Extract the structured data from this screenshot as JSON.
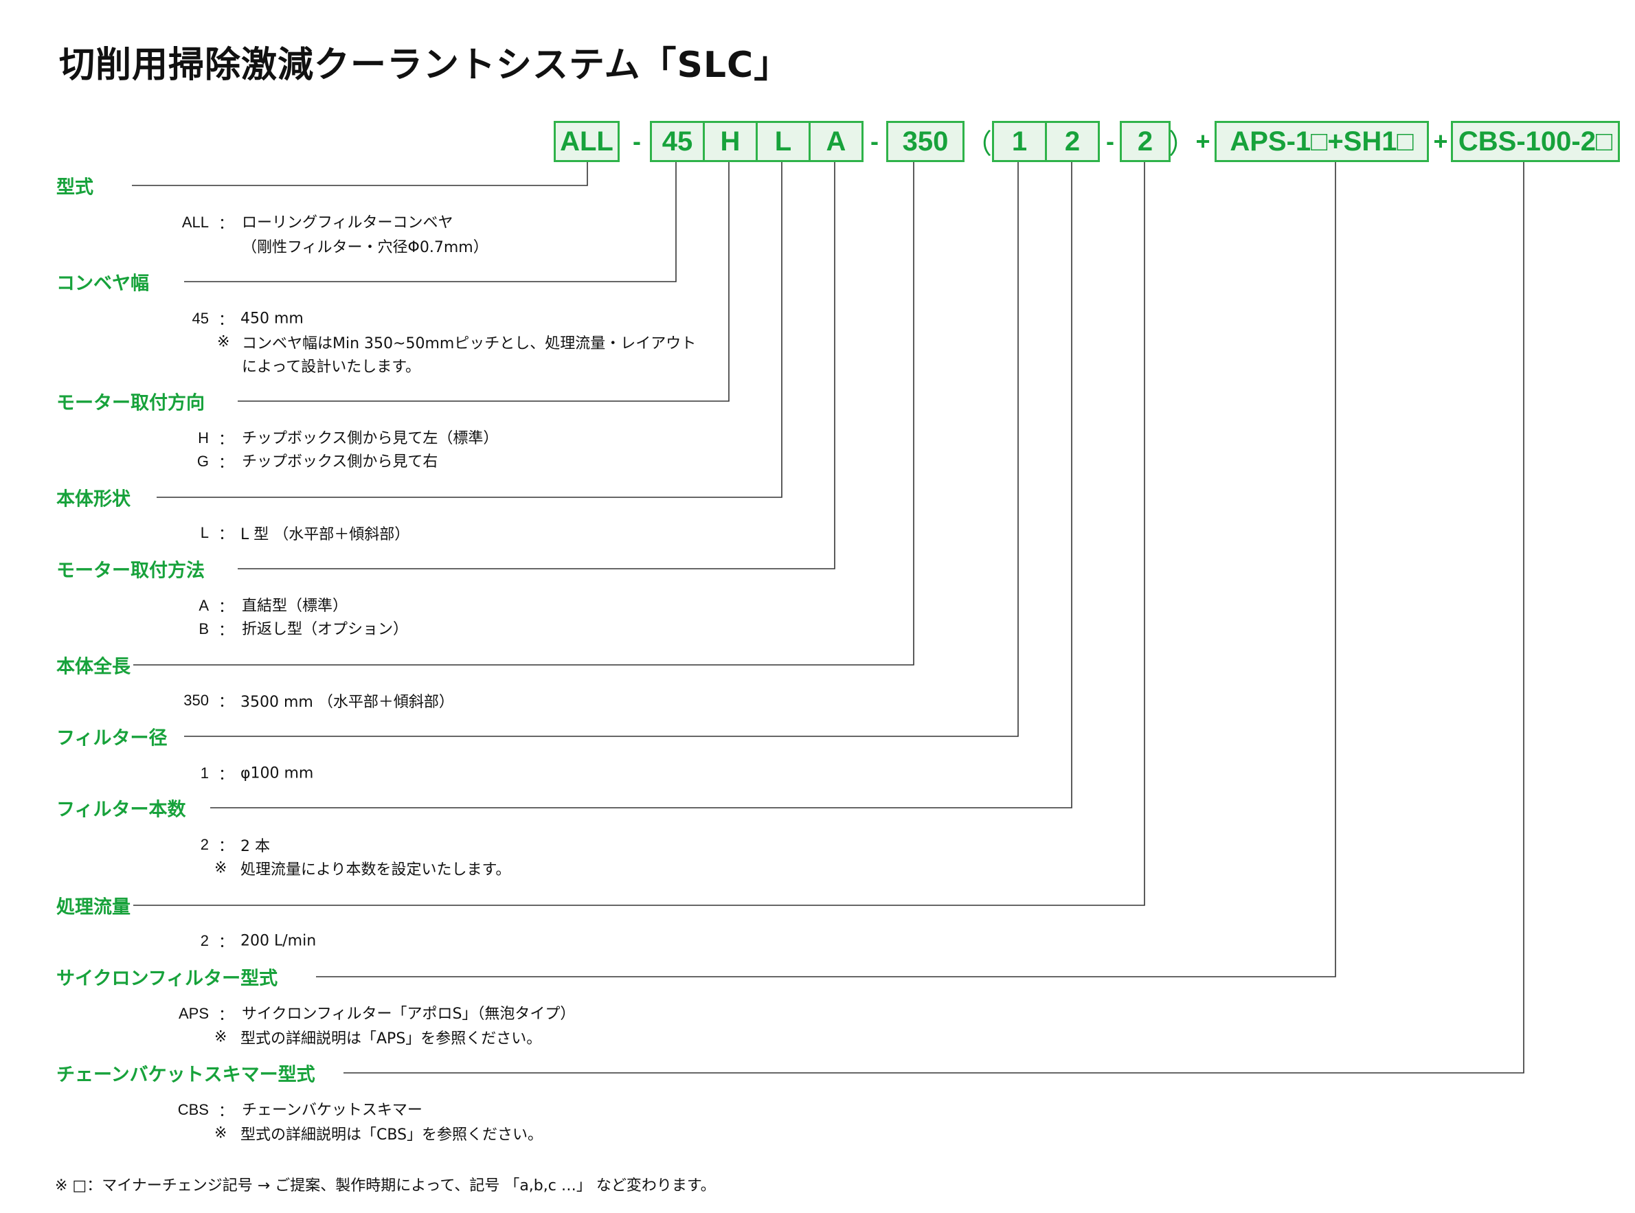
{
  "title": "切削用掃除激減クーラントシステム「SLC」",
  "colors": {
    "accent": "#17a23b",
    "box_border": "#2fb34a",
    "box_fill": "#e8f5ea"
  },
  "model_code": {
    "boxes": [
      "ALL",
      "45",
      "H",
      "L",
      "A",
      "350",
      "1",
      "2",
      "2",
      "APS-1□+SH1□",
      "CBS-100-2□"
    ],
    "dashes": [
      "-",
      "-",
      "-"
    ],
    "open_paren": "（",
    "close_paren": "）",
    "plus": [
      "+",
      "+"
    ]
  },
  "sections": [
    {
      "heading": "型式",
      "entries": [
        {
          "code": "ALL",
          "colon": "：",
          "lines": [
            "ローリングフィルターコンベヤ",
            "（剛性フィルター・穴径Φ0.7mm）"
          ]
        }
      ]
    },
    {
      "heading": "コンベヤ幅",
      "entries": [
        {
          "code": "45",
          "colon": "：",
          "lines": [
            "450 mm"
          ]
        }
      ],
      "notes": [
        {
          "mark": "※",
          "lines": [
            "コンベヤ幅はMin 350~50mmピッチとし、処理流量・レイアウト",
            "によって設計いたします。"
          ]
        }
      ]
    },
    {
      "heading": "モーター取付方向",
      "entries": [
        {
          "code": "H",
          "colon": "：",
          "lines": [
            "チップボックス側から見て左（標準）"
          ]
        },
        {
          "code": "G",
          "colon": "：",
          "lines": [
            "チップボックス側から見て右"
          ]
        }
      ]
    },
    {
      "heading": "本体形状",
      "entries": [
        {
          "code": "L",
          "colon": "：",
          "lines": [
            "L 型 （水平部＋傾斜部）"
          ]
        }
      ]
    },
    {
      "heading": "モーター取付方法",
      "entries": [
        {
          "code": "A",
          "colon": "：",
          "lines": [
            "直結型（標準）"
          ]
        },
        {
          "code": "B",
          "colon": "：",
          "lines": [
            "折返し型（オプション）"
          ]
        }
      ]
    },
    {
      "heading": "本体全長",
      "entries": [
        {
          "code": "350",
          "colon": "：",
          "lines": [
            "3500 mm （水平部＋傾斜部）"
          ]
        }
      ]
    },
    {
      "heading": "フィルター径",
      "entries": [
        {
          "code": "1",
          "colon": "：",
          "lines": [
            "φ100 mm"
          ]
        }
      ]
    },
    {
      "heading": "フィルター本数",
      "entries": [
        {
          "code": "2",
          "colon": "：",
          "lines": [
            "2 本"
          ]
        }
      ],
      "notes": [
        {
          "mark": "※",
          "lines": [
            "処理流量により本数を設定いたします。"
          ]
        }
      ]
    },
    {
      "heading": "処理流量",
      "entries": [
        {
          "code": "2",
          "colon": "：",
          "lines": [
            "200 L/min"
          ]
        }
      ]
    },
    {
      "heading": "サイクロンフィルター型式",
      "entries": [
        {
          "code": "APS",
          "colon": "：",
          "lines": [
            "サイクロンフィルター「アポロS」（無泡タイプ）"
          ]
        }
      ],
      "notes": [
        {
          "mark": "※",
          "lines": [
            "型式の詳細説明は「APS」を参照ください。"
          ]
        }
      ]
    },
    {
      "heading": "チェーンバケットスキマー型式",
      "entries": [
        {
          "code": "CBS",
          "colon": "：",
          "lines": [
            "チェーンバケットスキマー"
          ]
        }
      ],
      "notes": [
        {
          "mark": "※",
          "lines": [
            "型式の詳細説明は「CBS」を参照ください。"
          ]
        }
      ]
    }
  ],
  "footnote": "※ □：マイナーチェンジ記号 → ご提案、製作時期によって、記号 「a,b,c …」 など変わります。"
}
